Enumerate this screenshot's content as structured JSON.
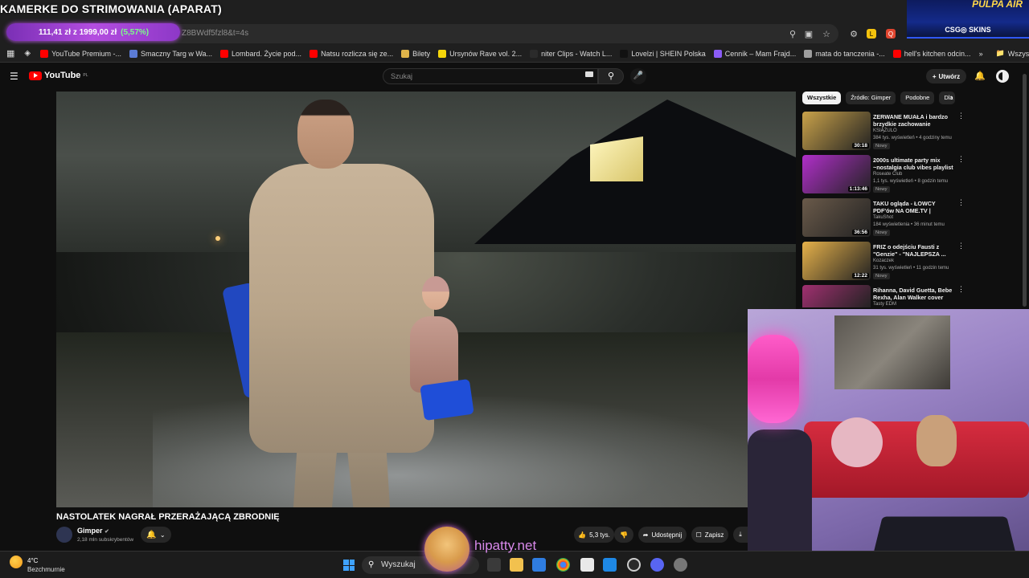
{
  "stream": {
    "title": "KAMERKE DO STRIMOWANIA (APARAT)",
    "price_current": "111,41 zł",
    "price_sep": "z",
    "price_goal": "1999,00 zł",
    "price_pct": "(5,57%)",
    "csgo_top": "PULPA AIR",
    "csgo_label": "CSG◎ SKINS",
    "hipatty": "hipatty.net"
  },
  "browser": {
    "url": "Z8BWdf5fzl8&t=4s",
    "bookmarks": [
      {
        "label": "YouTube Premium -...",
        "color": "#ff0000"
      },
      {
        "label": "Smaczny Targ w Wa...",
        "color": "#5b7bd5"
      },
      {
        "label": "Lombard. Życie pod...",
        "color": "#ff0000"
      },
      {
        "label": "Natsu rozlicza się ze...",
        "color": "#ff0000"
      },
      {
        "label": "Bilety",
        "color": "#e0b44a"
      },
      {
        "label": "Ursynów Rave vol. 2...",
        "color": "#f5d60a"
      },
      {
        "label": "niter Clips - Watch L...",
        "color": "#2b2b2b"
      },
      {
        "label": "Lovelzi | SHEIN Polska",
        "color": "#111111"
      },
      {
        "label": "Cennik – Mam Frajd...",
        "color": "#8b5cf6"
      },
      {
        "label": "mata do tanczenia -...",
        "color": "#9e9e9e"
      },
      {
        "label": "hell's kitchen odcin...",
        "color": "#ff0000"
      }
    ],
    "all_bookmarks": "Wszystkie zakładki"
  },
  "youtube": {
    "logo": "YouTube",
    "region": "PL",
    "search_placeholder": "Szukaj",
    "create_label": "Utwórz",
    "video_title": "NASTOLATEK NAGRAŁ PRZERAŻAJĄCĄ ZBRODNIĘ",
    "channel_name": "Gimper",
    "channel_subs": "2,18 mln subskrybentów",
    "likes": "5,3 tys.",
    "share_label": "Udostępnij",
    "save_label": "Zapisz",
    "chips": [
      "Wszystkie",
      "Źródło: Gimper",
      "Podobne",
      "Dla"
    ],
    "recommendations": [
      {
        "title": "ZERWANE MUAŁA i bardzo brzydkie zachowanie",
        "channel": "KSIĄŻULO",
        "meta": "384 tys. wyświetleń • 4 godziny temu",
        "badge": "Nowy",
        "duration": "30:18",
        "thumb": "#c9a24a"
      },
      {
        "title": "2000s ultimate party mix ~nostalgia club vibes playlist",
        "channel": "Roseate Club",
        "meta": "1,1 tys. wyświetleń • 8 godzin temu",
        "badge": "Nowy",
        "duration": "1:13:46",
        "thumb": "#b02fc9"
      },
      {
        "title": "TAKU ogląda - ŁOWCY PDF'ów NA OME.TV | w/NEEX, ...",
        "channel": "TakuShot",
        "meta": "184 wyświetlenia • 36 minut temu",
        "badge": "Nowy",
        "duration": "36:56",
        "thumb": "#6a5a4a"
      },
      {
        "title": "FRIZ o odejściu Fausti z \"Genzie\" - \"NAJLEPSZA ...",
        "channel": "Kozaczek",
        "meta": "31 tys. wyświetleń • 11 godzin temu",
        "badge": "Nowy",
        "duration": "12:22",
        "thumb": "#e6b14a"
      },
      {
        "title": "Rihanna, David Guetta, Bebe Rexha, Alan Walker cover style...",
        "channel": "Tasty EDM",
        "meta": "",
        "badge": "",
        "duration": "",
        "thumb": "#a03070"
      }
    ]
  },
  "taskbar": {
    "temp": "4°C",
    "weather": "Bezchmurnie",
    "search_placeholder": "Wyszukaj"
  }
}
